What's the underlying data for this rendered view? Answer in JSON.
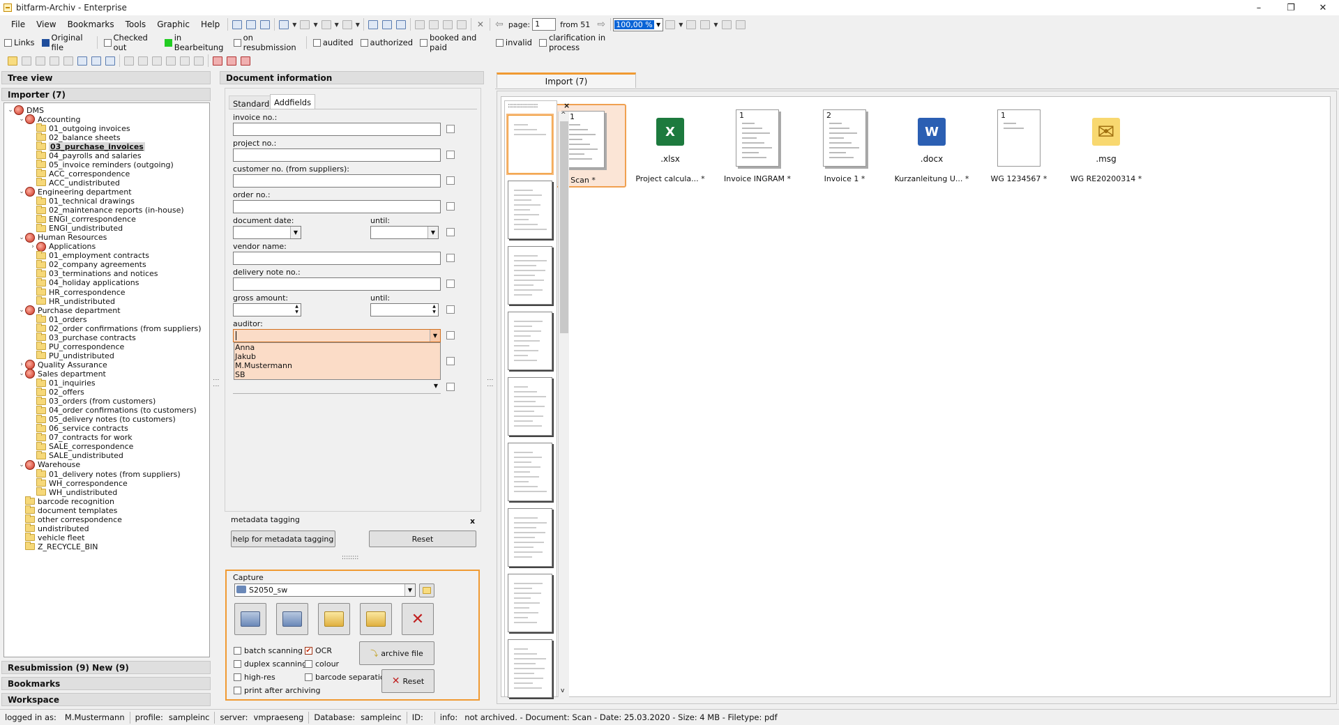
{
  "window": {
    "title": "bitfarm-Archiv - Enterprise",
    "min": "–",
    "max": "❐",
    "close": "✕"
  },
  "menu": [
    "File",
    "View",
    "Bookmarks",
    "Tools",
    "Graphic",
    "Help"
  ],
  "toolbar": {
    "page_label": "page:",
    "page_value": "1",
    "from_label": "from 51",
    "zoom": "100,00 %"
  },
  "filters": [
    {
      "label": "Links",
      "type": "check"
    },
    {
      "label": "Original file",
      "type": "swatch",
      "color": "#1f4e9c"
    },
    {
      "label": "Checked out",
      "type": "check"
    },
    {
      "label": "in Bearbeitung",
      "type": "swatch",
      "color": "#22cc22"
    },
    {
      "label": "on resubmission",
      "type": "check"
    },
    {
      "label": "audited",
      "type": "check"
    },
    {
      "label": "authorized",
      "type": "check"
    },
    {
      "label": "booked and paid",
      "type": "check"
    },
    {
      "label": "invalid",
      "type": "check"
    },
    {
      "label": "clarification in process",
      "type": "check"
    }
  ],
  "left": {
    "tree_view": "Tree view",
    "importer": "Importer (7)",
    "resubmission": "Resubmission (9)  New (9)",
    "bookmarks": "Bookmarks",
    "workspace": "Workspace"
  },
  "tree": [
    {
      "l": 0,
      "t": "net",
      "e": "v",
      "label": "DMS"
    },
    {
      "l": 1,
      "t": "net",
      "e": "v",
      "label": "Accounting"
    },
    {
      "l": 2,
      "t": "fold",
      "label": "01_outgoing invoices"
    },
    {
      "l": 2,
      "t": "fold",
      "label": "02_balance sheets"
    },
    {
      "l": 2,
      "t": "fold",
      "label": "03_purchase_invoices",
      "sel": true
    },
    {
      "l": 2,
      "t": "fold",
      "label": "04_payrolls and salaries"
    },
    {
      "l": 2,
      "t": "fold",
      "label": "05_invoice reminders (outgoing)"
    },
    {
      "l": 2,
      "t": "fold",
      "label": "ACC_correspondence"
    },
    {
      "l": 2,
      "t": "fold",
      "label": "ACC_undistributed"
    },
    {
      "l": 1,
      "t": "net",
      "e": "v",
      "label": "Engineering department"
    },
    {
      "l": 2,
      "t": "fold",
      "label": "01_technical drawings"
    },
    {
      "l": 2,
      "t": "fold",
      "label": "02_maintenance reports (in-house)"
    },
    {
      "l": 2,
      "t": "fold",
      "label": "ENGI_corrrespondence"
    },
    {
      "l": 2,
      "t": "fold",
      "label": "ENGI_undistributed"
    },
    {
      "l": 1,
      "t": "net",
      "e": "v",
      "label": "Human Resources"
    },
    {
      "l": 2,
      "t": "net",
      "e": ">",
      "label": "Applications"
    },
    {
      "l": 2,
      "t": "fold",
      "label": "01_employment contracts"
    },
    {
      "l": 2,
      "t": "fold",
      "label": "02_company agreements"
    },
    {
      "l": 2,
      "t": "fold",
      "label": "03_terminations and notices"
    },
    {
      "l": 2,
      "t": "fold",
      "label": "04_holiday applications"
    },
    {
      "l": 2,
      "t": "fold",
      "label": "HR_correspondence"
    },
    {
      "l": 2,
      "t": "fold",
      "label": "HR_undistributed"
    },
    {
      "l": 1,
      "t": "net",
      "e": "v",
      "label": "Purchase department"
    },
    {
      "l": 2,
      "t": "fold",
      "label": "01_orders"
    },
    {
      "l": 2,
      "t": "fold",
      "label": "02_order confirmations (from suppliers)"
    },
    {
      "l": 2,
      "t": "fold",
      "label": "03_purchase contracts"
    },
    {
      "l": 2,
      "t": "fold",
      "label": "PU_correspondence"
    },
    {
      "l": 2,
      "t": "fold",
      "label": "PU_undistributed"
    },
    {
      "l": 1,
      "t": "net",
      "e": ">",
      "label": "Quality Assurance"
    },
    {
      "l": 1,
      "t": "net",
      "e": "v",
      "label": "Sales department"
    },
    {
      "l": 2,
      "t": "fold",
      "label": "01_inquiries"
    },
    {
      "l": 2,
      "t": "fold",
      "label": "02_offers"
    },
    {
      "l": 2,
      "t": "fold",
      "label": "03_orders (from customers)"
    },
    {
      "l": 2,
      "t": "fold",
      "label": "04_order confirmations (to customers)"
    },
    {
      "l": 2,
      "t": "fold",
      "label": "05_delivery notes (to customers)"
    },
    {
      "l": 2,
      "t": "fold",
      "label": "06_service contracts"
    },
    {
      "l": 2,
      "t": "fold",
      "label": "07_contracts for work"
    },
    {
      "l": 2,
      "t": "fold",
      "label": "SALE_correspondence"
    },
    {
      "l": 2,
      "t": "fold",
      "label": "SALE_undistributed"
    },
    {
      "l": 1,
      "t": "net",
      "e": "v",
      "label": "Warehouse"
    },
    {
      "l": 2,
      "t": "fold",
      "label": "01_delivery notes (from suppliers)"
    },
    {
      "l": 2,
      "t": "fold",
      "label": "WH_correspondence"
    },
    {
      "l": 2,
      "t": "fold",
      "label": "WH_undistributed"
    },
    {
      "l": 1,
      "t": "fold",
      "label": "barcode recognition"
    },
    {
      "l": 1,
      "t": "fold",
      "label": "document templates"
    },
    {
      "l": 1,
      "t": "fold",
      "label": "other correspondence"
    },
    {
      "l": 1,
      "t": "fold",
      "label": "undistributed"
    },
    {
      "l": 1,
      "t": "fold",
      "label": "vehicle fleet"
    },
    {
      "l": 1,
      "t": "fold",
      "label": "Z_RECYCLE_BIN"
    }
  ],
  "docinfo": {
    "header": "Document information",
    "tabs": [
      "Standard",
      "Addfields"
    ],
    "fields": {
      "invoice": "invoice no.:",
      "project": "project no.:",
      "customer": "customer no. (from suppliers):",
      "order": "order no.:",
      "docdate": "document date:",
      "until": "until:",
      "vendor": "vendor name:",
      "delivery": "delivery note no.:",
      "gross": "gross amount:",
      "auditor": "auditor:"
    },
    "auditor_options": [
      "Anna",
      "Jakub",
      "M.Mustermann",
      "SB"
    ],
    "metadata": {
      "title": "metadata tagging",
      "help": "help for metadata tagging",
      "reset": "Reset",
      "close": "x"
    },
    "splitter": "::::::::"
  },
  "capture": {
    "title": "Capture",
    "scanner": "S2050_sw",
    "options": {
      "batch": "batch scanning",
      "ocr": "OCR",
      "duplex": "duplex scanning",
      "colour": "colour",
      "highres": "high-res",
      "barcode": "barcode separation",
      "print": "print after archiving"
    },
    "archive": "archive file",
    "reset": "Reset"
  },
  "import": {
    "tab": "Import (7)",
    "docs": [
      {
        "label": "Scan *",
        "num": "51",
        "kind": "scan"
      },
      {
        "label": "Project calcula... *",
        "ext": ".xlsx",
        "kind": "xlsx",
        "color": "#1d7a3e",
        "glyph": "X"
      },
      {
        "label": "Invoice INGRAM *",
        "num": "1",
        "kind": "doc"
      },
      {
        "label": "Invoice 1 *",
        "num": "2",
        "kind": "doc"
      },
      {
        "label": "Kurzanleitung U... *",
        "ext": ".docx",
        "kind": "docx",
        "color": "#2b5fb3",
        "glyph": "W"
      },
      {
        "label": "WG 1234567 *",
        "num": "1",
        "kind": "blank"
      },
      {
        "label": "WG RE20200314 *",
        "ext": ".msg",
        "kind": "msg",
        "color": "#f3c64a",
        "glyph": "✉"
      }
    ]
  },
  "status": {
    "logged": "logged in as:",
    "user": "M.Mustermann",
    "profile_l": "profile:",
    "profile": "sampleinc",
    "server_l": "server:",
    "server": "vmpraeseng",
    "db_l": "Database:",
    "db": "sampleinc",
    "id_l": "ID:",
    "info_l": "info:",
    "info": "not archived. - Document: Scan - Date: 25.03.2020 - Size: 4 MB - Filetype: pdf"
  }
}
